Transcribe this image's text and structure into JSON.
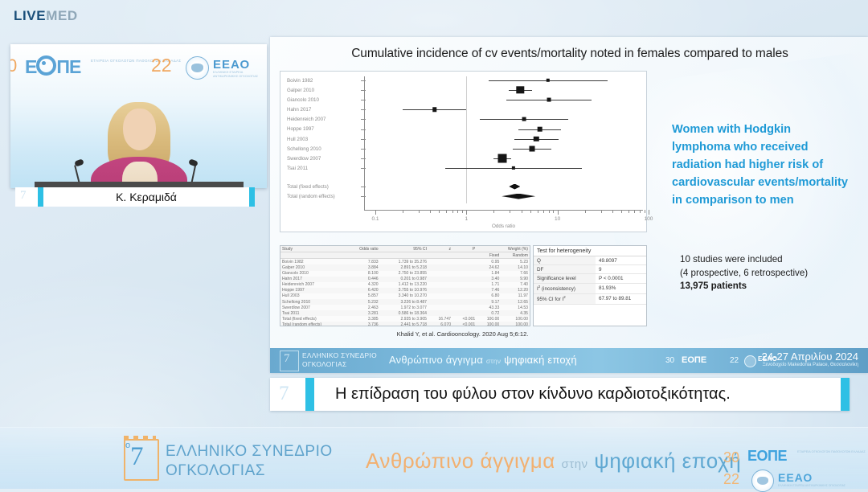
{
  "brand": {
    "live": "LIVE",
    "med": "MED"
  },
  "video": {
    "badge_number": "7",
    "logo_eope": "ΕΟΠΕ",
    "logo_eope_sub": "ΕΤΑΙΡΕΙΑ ΟΓΚΟΛΟΓΩΝ ΠΑΘΟΛΟΓΩΝ ΕΛΛΑΔΑΣ",
    "logo_22": "22",
    "logo_30_partial": "0",
    "logo_eeao": "ΕΕΑΟ",
    "logo_eeao_sub": "ΕΛΛΗΝΙΚΗ ΕΤΑΙΡΕΙΑ ΑΝΤΙΚΑΡΚΙΝΙΚΗΣ ΟΓΚΟΛΟΓΙΑΣ",
    "speaker_name": "Κ. Κεραμιδά"
  },
  "slide": {
    "title": "Cumulative incidence of cv events/mortality noted in females compared to males",
    "citation": "Khalid Y, et al. Cardiooncology. 2020 Aug 5;6:12.",
    "blue_message": "Women with Hodgkin lymphoma who received radiation had higher risk of cardiovascular events/mortality in comparison to men",
    "study_note_line1": "10 studies were included",
    "study_note_line2": "(4 prospective, 6 retrospective)",
    "study_note_line3": "13,975 patients",
    "accent_blue": "#1f9ad6"
  },
  "chart_data": {
    "type": "scatter",
    "subtype": "forest-plot",
    "title": "Cumulative incidence of cv events/mortality noted in females compared to males",
    "xlabel": "Odds ratio",
    "ylabel": "",
    "xscale": "log",
    "xlim": [
      0.1,
      100
    ],
    "xticks": [
      "0.1",
      "1",
      "10",
      "100"
    ],
    "null_line": 1,
    "grid": false,
    "legend": "none",
    "categories": [
      "Boivin 1982",
      "Galper 2010",
      "Giancolo 2010",
      "Hahn 2017",
      "Heidenreich 2007",
      "Hoppe 1997",
      "Hull 2003",
      "Schellong 2010",
      "Swerdlow 2007",
      "Tsai 2011",
      "Total (fixed effects)",
      "Total (random effects)"
    ],
    "points": [
      {
        "label": "Boivin 1982",
        "or": 7.833,
        "lo": 1.739,
        "hi": 35.276,
        "weight_fixed": 0.95,
        "weight_random": 5.23
      },
      {
        "label": "Galper 2010",
        "or": 3.884,
        "lo": 2.891,
        "hi": 5.218,
        "weight_fixed": 24.62,
        "weight_random": 14.1
      },
      {
        "label": "Giancolo 2010",
        "or": 8.1,
        "lo": 2.75,
        "hi": 23.855,
        "weight_fixed": 1.84,
        "weight_random": 7.66
      },
      {
        "label": "Hahn 2017",
        "or": 0.446,
        "lo": 0.201,
        "hi": 0.987,
        "weight_fixed": 3.4,
        "weight_random": 9.9
      },
      {
        "label": "Heidenreich 2007",
        "or": 4.32,
        "lo": 1.412,
        "hi": 13.22,
        "weight_fixed": 1.71,
        "weight_random": 7.4
      },
      {
        "label": "Hoppe 1997",
        "or": 6.42,
        "lo": 3.755,
        "hi": 10.976,
        "weight_fixed": 7.46,
        "weight_random": 12.2
      },
      {
        "label": "Hull 2003",
        "or": 5.857,
        "lo": 3.34,
        "hi": 10.27,
        "weight_fixed": 6.8,
        "weight_random": 11.97
      },
      {
        "label": "Schellong 2010",
        "or": 5.232,
        "lo": 3.226,
        "hi": 8.487,
        "weight_fixed": 9.17,
        "weight_random": 12.65
      },
      {
        "label": "Swerdlow 2007",
        "or": 2.463,
        "lo": 1.972,
        "hi": 3.077,
        "weight_fixed": 43.33,
        "weight_random": 14.53
      },
      {
        "label": "Tsai 2011",
        "or": 3.281,
        "lo": 0.586,
        "hi": 18.364,
        "weight_fixed": 0.72,
        "weight_random": 4.35
      },
      {
        "label": "Total (fixed effects)",
        "or": 3.385,
        "lo": 2.935,
        "hi": 3.905,
        "weight_fixed": 100.0,
        "weight_random": 100.0,
        "diamond": true
      },
      {
        "label": "Total (random effects)",
        "or": 3.736,
        "lo": 2.441,
        "hi": 5.718,
        "weight_fixed": 100.0,
        "weight_random": 100.0,
        "diamond": true
      }
    ]
  },
  "results_table": {
    "headers_top": [
      "Study",
      "Odds ratio",
      "95% CI",
      "z",
      "P",
      "Weight (%)"
    ],
    "headers_sub": [
      "Fixed",
      "Random"
    ],
    "rows": [
      [
        "Boivin 1982",
        "7.833",
        "1.739 to 35.276",
        "",
        "",
        "0.95",
        "5.23"
      ],
      [
        "Galper 2010",
        "3.884",
        "2.891 to 5.218",
        "",
        "",
        "24.62",
        "14.10"
      ],
      [
        "Giancolo 2010",
        "8.100",
        "2.750 to 23.855",
        "",
        "",
        "1.84",
        "7.66"
      ],
      [
        "Hahn 2017",
        "0.446",
        "0.201 to 0.987",
        "",
        "",
        "3.40",
        "9.90"
      ],
      [
        "Heidenreich 2007",
        "4.320",
        "1.412 to 13.220",
        "",
        "",
        "1.71",
        "7.40"
      ],
      [
        "Hoppe 1997",
        "6.420",
        "3.755 to 10.976",
        "",
        "",
        "7.46",
        "12.20"
      ],
      [
        "Hull 2003",
        "5.857",
        "3.340 to 10.270",
        "",
        "",
        "6.80",
        "11.97"
      ],
      [
        "Schellong 2010",
        "5.232",
        "3.226 to 8.487",
        "",
        "",
        "9.17",
        "12.65"
      ],
      [
        "Swerdlow 2007",
        "2.463",
        "1.972 to 3.077",
        "",
        "",
        "43.33",
        "14.53"
      ],
      [
        "Tsai 2011",
        "3.281",
        "0.586 to 18.364",
        "",
        "",
        "0.72",
        "4.35"
      ],
      [
        "Total (fixed effects)",
        "3.385",
        "2.935 to 3.905",
        "16.747",
        "<0.001",
        "100.00",
        "100.00"
      ],
      [
        "Total (random effects)",
        "3.736",
        "2.441 to 5.718",
        "6.070",
        "<0.001",
        "100.00",
        "100.00"
      ]
    ]
  },
  "heterogeneity": {
    "title": "Test for heterogeneity",
    "rows": [
      {
        "key": "Q",
        "value": "49.8097"
      },
      {
        "key": "DF",
        "value": "9"
      },
      {
        "key": "Significance level",
        "value": "P < 0.0001"
      },
      {
        "key": "I2 (inconsistency)",
        "value": "81.93%"
      },
      {
        "key": "95% CI for I2",
        "value": "67.97 to 89.81"
      }
    ]
  },
  "slide_banner": {
    "badge_number": "7",
    "congress_line1": "ΕΛΛΗΝΙΚΟ ΣΥΝΕΔΡΙΟ",
    "congress_line2": "ΟΓΚΟΛΟΓΙΑΣ",
    "theme_orange": "Ανθρώπινο άγγιγμα",
    "theme_thin": "στην",
    "theme_bold": "ψηφιακή εποχή",
    "num30": "30",
    "eope": "ΕΟΠΕ",
    "num22": "22",
    "eeao": "ΕΕΑΟ",
    "dates": "24-27 Απριλίου 2024",
    "venue": "Ξενοδοχείο Makedonia Palace, Θεσσαλονίκη"
  },
  "lecture": {
    "badge_number": "7",
    "title": "Η επίδραση του φύλου στον κίνδυνο καρδιοτοξικότητας.",
    "accent": "#2ec0e5"
  },
  "footer": {
    "badge_number": "7",
    "congress_line1": "ΕΛΛΗΝΙΚΟ ΣΥΝΕΔΡΙΟ",
    "congress_line2": "ΟΓΚΟΛΟΓΙΑΣ",
    "theme_orange": "Ανθρώπινο άγγιγμα",
    "theme_thin": "στην",
    "theme_bold": "ψηφιακή εποχή",
    "num30": "30",
    "eope": "ΕΟΠΕ",
    "eope_sub": "ΕΤΑΙΡΕΙΑ ΟΓΚΟΛΟΓΩΝ ΠΑΘΟΛΟΓΩΝ ΕΛΛΑΔΑΣ",
    "num22": "22",
    "eeao": "ΕΕΑΟ",
    "eeao_sub": "ΕΛΛΗΝΙΚΗ ΕΤΑΙΡΕΙΑ ΑΝΤΙΚΑΡΚΙΝΙΚΗΣ ΟΓΚΟΛΟΓΙΑΣ"
  }
}
